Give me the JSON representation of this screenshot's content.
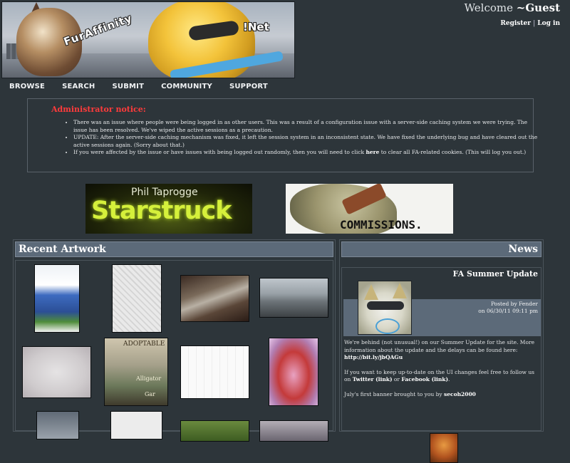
{
  "header": {
    "logo_text": "FurAffinity",
    "logo_suffix": "!Net",
    "welcome_prefix": "Welcome",
    "username": "~Guest",
    "register_label": "Register",
    "auth_separator": "|",
    "login_label": "Log in"
  },
  "nav": {
    "browse": "BROWSE",
    "search": "SEARCH",
    "submit": "SUBMIT",
    "community": "COMMUNITY",
    "support": "SUPPORT"
  },
  "notice": {
    "title": "Administrator notice:",
    "items": [
      "There was an issue where people were being logged in as other users. This was a result of a configuration issue with a server-side caching system we were trying. The issue has been resolved. We've wiped the active sessions as a precaution.",
      "UPDATE: After the server-side caching mechanism was fixed, it left the session system in an inconsistent state. We have fixed the underlying bug and have cleared out the active sessions again. (Sorry about that.)"
    ],
    "item3_before": "If you were affected by the issue or have issues with being logged out randomly, then you will need to click",
    "item3_link": "here",
    "item3_after": "to clear all FA-related cookies. (This will log you out.)"
  },
  "ads": {
    "left_line1": "Phil Taprogge",
    "left_line2": "Starstruck",
    "right_text": "COMMISSIONS."
  },
  "recent": {
    "heading": "Recent Artwork",
    "thumb_adoptable_line1": "ADOPTABLE",
    "thumb_adoptable_line2": "Alligator",
    "thumb_adoptable_line3": "Gar"
  },
  "news": {
    "heading": "News",
    "title": "FA Summer Update",
    "posted_by": "Posted by Fender",
    "posted_on": "on 06/30/11 09:11 pm",
    "p1": "We're behind (not unusual!) on our Summer Update for the site. More information about the update and the delays can be found here:",
    "p1_link": "http://bit.ly/jbQAGu",
    "p2_before": "If you want to keep up-to-date on the UI changes feel free to follow us on",
    "p2_twitter": "Twitter (link)",
    "p2_or": "or",
    "p2_facebook": "Facebook (link)",
    "p3_before": "July's first banner brought to you by",
    "p3_author": "secoh2000"
  }
}
